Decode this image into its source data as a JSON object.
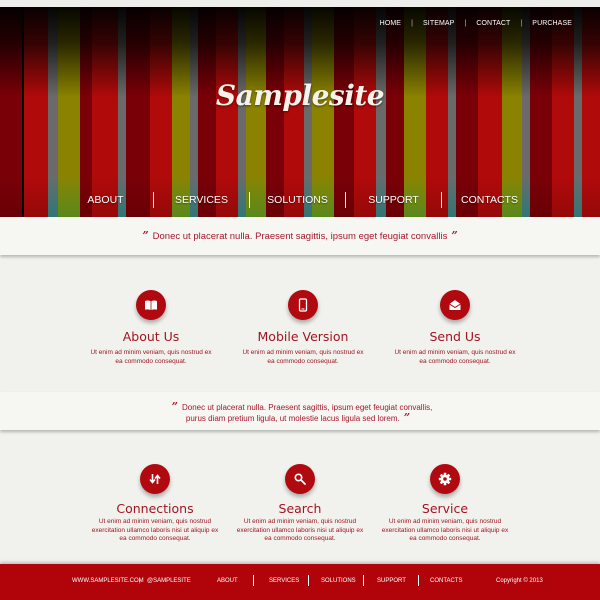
{
  "header": {
    "site_title": "Samplesite",
    "top_nav": [
      "HOME",
      "SITEMAP",
      "CONTACT",
      "PURCHASE"
    ],
    "top_nav_separator": "|",
    "main_nav": [
      "ABOUT",
      "SERVICES",
      "SOLUTIONS",
      "SUPPORT",
      "CONTACTS"
    ],
    "stripe_colors": {
      "red": "#b00a0a",
      "dark_red": "#7a0007",
      "olive": "#8a8200",
      "gray": "#6a6a6a",
      "teal": "#3a8a8a",
      "green": "#6aa020"
    }
  },
  "quote1": {
    "open": "”",
    "text": "Donec ut placerat nulla. Praesent sagittis, ipsum eget feugiat convallis",
    "close": "”"
  },
  "features_row1": [
    {
      "icon": "book-icon",
      "title": "About Us",
      "text": "Ut enim ad minim veniam, quis nostrud ex ea commodo consequat."
    },
    {
      "icon": "mobile-icon",
      "title": "Mobile Version",
      "text": "Ut enim ad minim veniam, quis nostrud ex ea commodo consequat."
    },
    {
      "icon": "envelope-icon",
      "title": "Send Us",
      "text": "Ut enim ad minim veniam, quis nostrud ex ea commodo consequat."
    }
  ],
  "quote2": {
    "open": "”",
    "line1": "Donec ut placerat nulla. Praesent sagittis, ipsum eget feugiat convallis,",
    "line2": "purus diam pretium ligula, ut molestie lacus ligula sed lorem.",
    "close": "”"
  },
  "features_row2": [
    {
      "icon": "transfer-arrows-icon",
      "title": "Connections",
      "text": "Ut enim ad minim veniam, quis nostrud exercitation ullamco laboris nisi ut aliquip ex ea commodo consequat."
    },
    {
      "icon": "search-icon",
      "title": "Search",
      "text": "Ut enim ad minim veniam, quis nostrud exercitation ullamco laboris nisi ut aliquip ex ea commodo consequat."
    },
    {
      "icon": "gear-icon",
      "title": "Service",
      "text": "Ut enim ad minim veniam, quis nostrud exercitation ullamco laboris nisi ut aliquip ex ea commodo consequat."
    }
  ],
  "footer": {
    "website": "WWW.SAMPLESITE.COM",
    "separator": "|",
    "handle": "@SAMPLESITE",
    "nav": [
      "ABOUT",
      "SERVICES",
      "SOLUTIONS",
      "SUPPORT",
      "CONTACTS"
    ],
    "copyright": "Copyright © 2013"
  },
  "colors": {
    "accent": "#b00a10",
    "text_red": "#a01522",
    "background": "#f1f2ee",
    "footer": "#b0040a"
  }
}
